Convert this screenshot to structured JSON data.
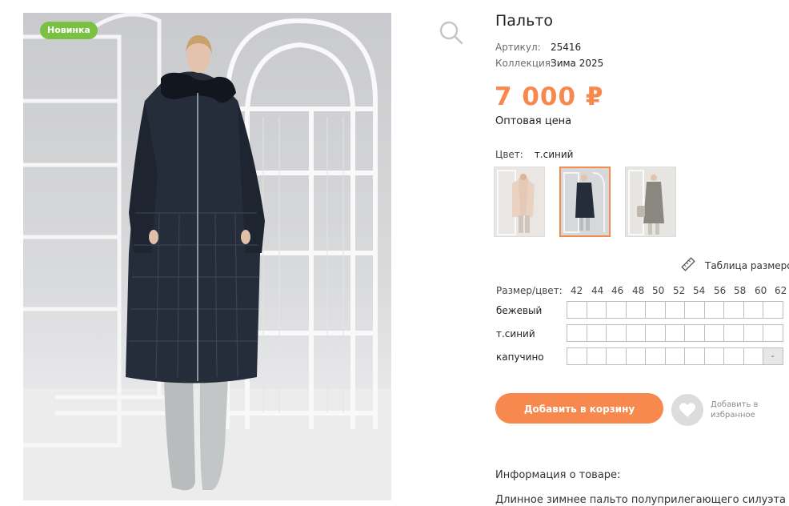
{
  "product": {
    "badge": "Новинка",
    "title": "Пальто",
    "article_label": "Артикул:",
    "article_value": "25416",
    "collection_label": "Коллекция:",
    "collection_value": "Зима 2025",
    "price": "7 000 ₽",
    "price_note": "Оптовая цена",
    "color_label": "Цвет:",
    "color_value": "т.синий"
  },
  "swatches": [
    {
      "name": "бежевый",
      "selected": false
    },
    {
      "name": "т.синий",
      "selected": true
    },
    {
      "name": "капучино",
      "selected": false
    }
  ],
  "size_table_link": "Таблица размеров",
  "grid": {
    "header_label": "Размер/цвет:",
    "sizes": [
      "42",
      "44",
      "46",
      "48",
      "50",
      "52",
      "54",
      "56",
      "58",
      "60",
      "62"
    ],
    "rows": [
      {
        "color": "бежевый",
        "unavailable_last": false
      },
      {
        "color": "т.синий",
        "unavailable_last": false
      },
      {
        "color": "капучино",
        "unavailable_last": true,
        "unavailable_mark": "-"
      }
    ]
  },
  "actions": {
    "add_to_cart": "Добавить в корзину",
    "favorite": "Добавить в\nизбранное"
  },
  "info": {
    "title": "Информация о товаре:",
    "text": "Длинное зимнее пальто полуприлегающего силуэта"
  },
  "icons": {
    "zoom": "magnifier-icon",
    "size_table": "ruler-icon",
    "favorite": "heart-icon"
  },
  "colors": {
    "accent": "#f7894e",
    "badge": "#7ac143",
    "coat": "#262d3a"
  }
}
